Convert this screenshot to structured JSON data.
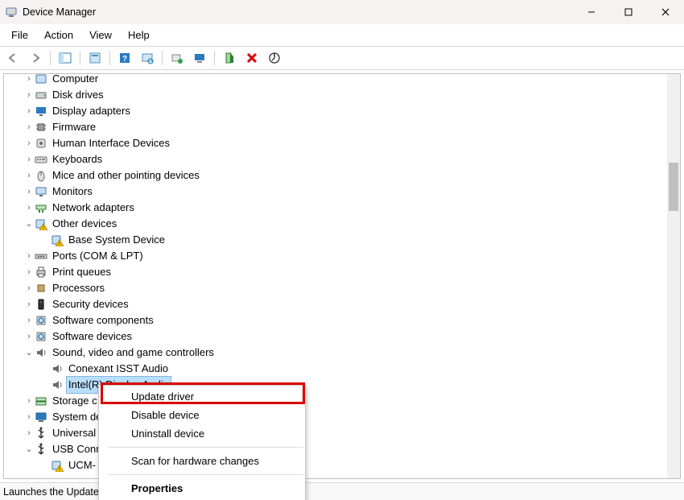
{
  "window": {
    "title": "Device Manager"
  },
  "menu": {
    "items": [
      "File",
      "Action",
      "View",
      "Help"
    ]
  },
  "tree": {
    "nodes": [
      {
        "label": "Computer",
        "indent": 0,
        "expander": "›",
        "icon": "computer-icon"
      },
      {
        "label": "Disk drives",
        "indent": 0,
        "expander": "›",
        "icon": "disk-icon"
      },
      {
        "label": "Display adapters",
        "indent": 0,
        "expander": "›",
        "icon": "display-icon"
      },
      {
        "label": "Firmware",
        "indent": 0,
        "expander": "›",
        "icon": "chip-icon"
      },
      {
        "label": "Human Interface Devices",
        "indent": 0,
        "expander": "›",
        "icon": "hid-icon"
      },
      {
        "label": "Keyboards",
        "indent": 0,
        "expander": "›",
        "icon": "keyboard-icon"
      },
      {
        "label": "Mice and other pointing devices",
        "indent": 0,
        "expander": "›",
        "icon": "mouse-icon"
      },
      {
        "label": "Monitors",
        "indent": 0,
        "expander": "›",
        "icon": "monitor-icon"
      },
      {
        "label": "Network adapters",
        "indent": 0,
        "expander": "›",
        "icon": "network-icon"
      },
      {
        "label": "Other devices",
        "indent": 0,
        "expander": "⌄",
        "icon": "warning-icon"
      },
      {
        "label": "Base System Device",
        "indent": 1,
        "expander": "",
        "icon": "warning-icon"
      },
      {
        "label": "Ports (COM & LPT)",
        "indent": 0,
        "expander": "›",
        "icon": "port-icon"
      },
      {
        "label": "Print queues",
        "indent": 0,
        "expander": "›",
        "icon": "printer-icon"
      },
      {
        "label": "Processors",
        "indent": 0,
        "expander": "›",
        "icon": "cpu-icon"
      },
      {
        "label": "Security devices",
        "indent": 0,
        "expander": "›",
        "icon": "security-icon"
      },
      {
        "label": "Software components",
        "indent": 0,
        "expander": "›",
        "icon": "software-icon"
      },
      {
        "label": "Software devices",
        "indent": 0,
        "expander": "›",
        "icon": "software-icon"
      },
      {
        "label": "Sound, video and game controllers",
        "indent": 0,
        "expander": "⌄",
        "icon": "sound-icon"
      },
      {
        "label": "Conexant ISST Audio",
        "indent": 1,
        "expander": "",
        "icon": "sound-icon"
      },
      {
        "label": "Intel(R) Display Audio",
        "indent": 1,
        "expander": "",
        "icon": "sound-icon",
        "selected": true
      },
      {
        "label": "Storage controllers",
        "indent": 0,
        "expander": "›",
        "icon": "storage-icon"
      },
      {
        "label": "System devices",
        "indent": 0,
        "expander": "›",
        "icon": "system-icon"
      },
      {
        "label": "Universal Serial Bus controllers",
        "indent": 0,
        "expander": "›",
        "icon": "usb-icon"
      },
      {
        "label": "USB Connector Managers",
        "indent": 0,
        "expander": "⌄",
        "icon": "usb-icon"
      },
      {
        "label": "UCM-UCSI ACPI Device",
        "indent": 1,
        "expander": "",
        "icon": "warning-icon"
      }
    ]
  },
  "context_menu": {
    "items": [
      {
        "label": "Update driver",
        "highlight": true
      },
      {
        "label": "Disable device"
      },
      {
        "label": "Uninstall device"
      },
      {
        "sep": true
      },
      {
        "label": "Scan for hardware changes"
      },
      {
        "sep": true
      },
      {
        "label": "Properties",
        "bold": true
      }
    ]
  },
  "statusbar": {
    "text": "Launches the Update Driver Wizard for the selected device."
  },
  "truncation": {
    "status_cut": "Launches the Update",
    "sel_cut": "Intel(R) Display Audio",
    "storage_cut": "Storage c",
    "system_cut": "System de",
    "universal_cut": "Universal",
    "usbconn_cut": "USB Conn",
    "ucm_cut": "UCM-"
  }
}
